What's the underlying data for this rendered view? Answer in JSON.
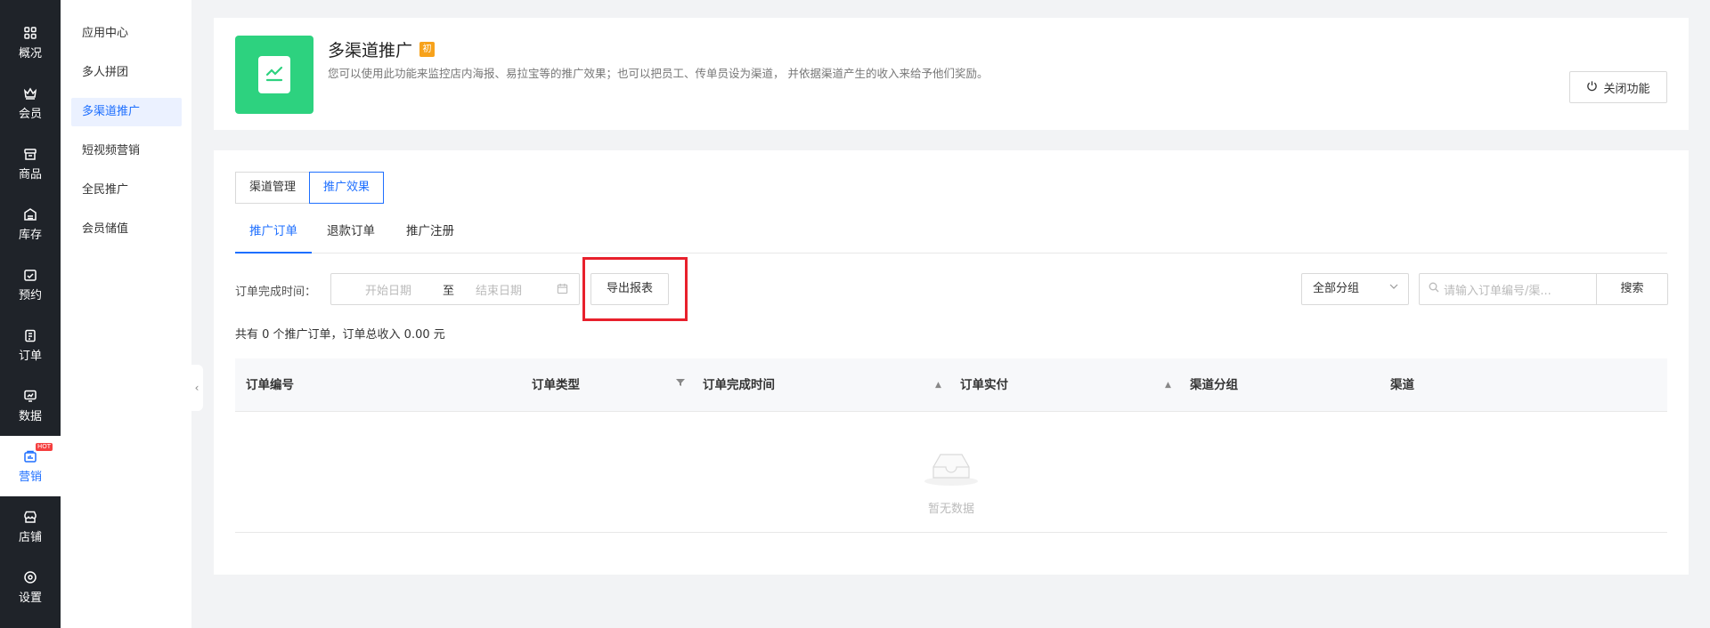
{
  "nav": [
    {
      "label": "概况",
      "icon": "grid-icon"
    },
    {
      "label": "会员",
      "icon": "crown-icon"
    },
    {
      "label": "商品",
      "icon": "store-box-icon"
    },
    {
      "label": "库存",
      "icon": "inventory-icon"
    },
    {
      "label": "预约",
      "icon": "calendar-check-icon"
    },
    {
      "label": "订单",
      "icon": "clipboard-icon"
    },
    {
      "label": "数据",
      "icon": "chart-monitor-icon"
    },
    {
      "label": "营销",
      "icon": "marketing-icon",
      "badge": "HOT"
    },
    {
      "label": "店铺",
      "icon": "shop-icon"
    },
    {
      "label": "设置",
      "icon": "settings-icon"
    }
  ],
  "submenu": [
    "应用中心",
    "多人拼团",
    "多渠道推广",
    "短视频营销",
    "全民推广",
    "会员储值"
  ],
  "header": {
    "title": "多渠道推广",
    "badge": "初",
    "description": "您可以使用此功能来监控店内海报、易拉宝等的推广效果；也可以把员工、传单员设为渠道， 并依据渠道产生的收入来给予他们奖励。",
    "close_label": "关闭功能"
  },
  "segments": [
    "渠道管理",
    "推广效果"
  ],
  "tabs": [
    "推广订单",
    "退款订单",
    "推广注册"
  ],
  "filter": {
    "label": "订单完成时间：",
    "start_placeholder": "开始日期",
    "separator": "至",
    "end_placeholder": "结束日期",
    "export_label": "导出报表",
    "group_value": "全部分组",
    "search_placeholder": "请输入订单编号/渠...",
    "search_label": "搜索"
  },
  "summary": "共有 0 个推广订单，订单总收入 0.00 元",
  "table": {
    "columns": [
      "订单编号",
      "订单类型",
      "订单完成时间",
      "订单实付",
      "渠道分组",
      "渠道"
    ],
    "empty_text": "暂无数据"
  },
  "colors": {
    "accent": "#1e6fff",
    "nav_bg": "#1f2329",
    "app_icon": "#2dd27f",
    "badge": "#f7a21b",
    "highlight": "#e8202c"
  }
}
